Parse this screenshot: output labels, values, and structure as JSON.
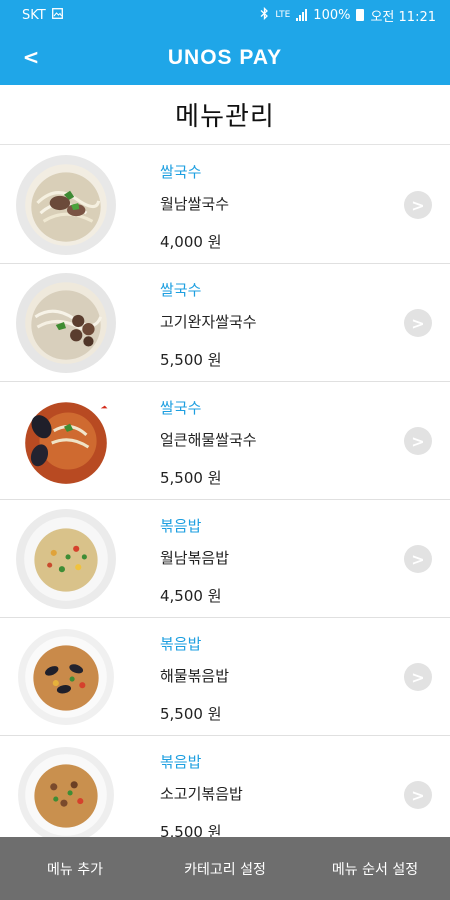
{
  "status_bar": {
    "carrier": "SKT",
    "network": "LTE",
    "battery": "100%",
    "time": "오전 11:21",
    "icons": [
      "image-icon",
      "bluetooth-icon",
      "signal-icon",
      "battery-icon"
    ]
  },
  "app_bar": {
    "back_label": "<",
    "title": "UNOS PAY",
    "background": "#1fa6e8"
  },
  "page": {
    "title": "메뉴관리"
  },
  "menu_items": [
    {
      "category": "쌀국수",
      "name": "월남쌀국수",
      "price": "4,000 원",
      "chevron": ">"
    },
    {
      "category": "쌀국수",
      "name": "고기완자쌀국수",
      "price": "5,500 원",
      "chevron": ">"
    },
    {
      "category": "쌀국수",
      "name": "얼큰해물쌀국수",
      "price": "5,500 원",
      "chevron": ">"
    },
    {
      "category": "볶음밥",
      "name": "월남볶음밥",
      "price": "4,500 원",
      "chevron": ">"
    },
    {
      "category": "볶음밥",
      "name": "해물볶음밥",
      "price": "5,500 원",
      "chevron": ">"
    },
    {
      "category": "볶음밥",
      "name": "소고기볶음밥",
      "price": "5,500 원",
      "chevron": ">"
    }
  ],
  "bottom_bar": {
    "add_menu": "메뉴 추가",
    "category_settings": "카테고리 설정",
    "menu_order_settings": "메뉴 순서 설정"
  },
  "colors": {
    "accent": "#1fa6e8",
    "category_text": "#1e9fe0",
    "bottom_bar": "#6e6e6e"
  }
}
